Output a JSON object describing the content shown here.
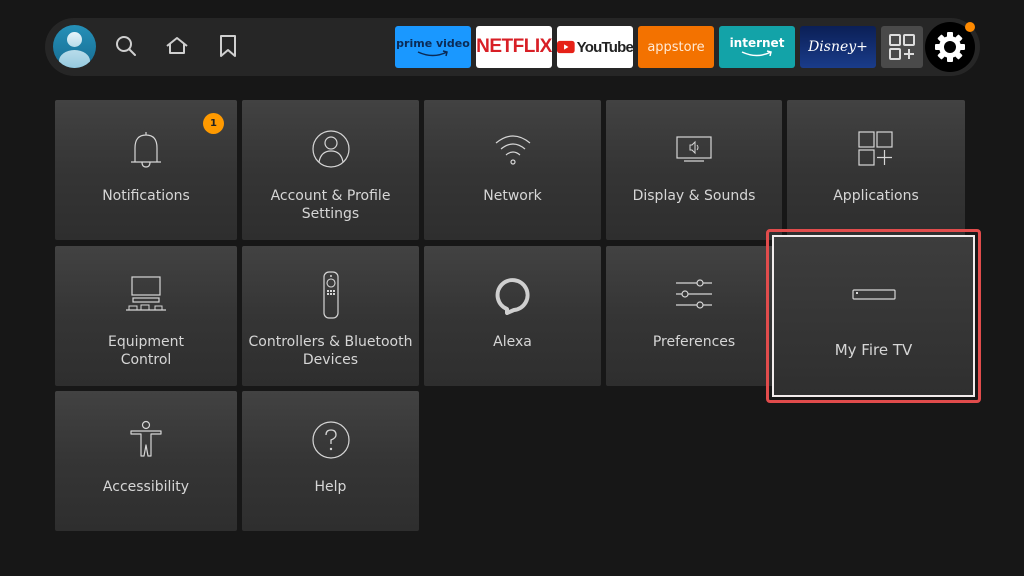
{
  "topbar": {
    "nav": [
      {
        "name": "profile",
        "icon": "avatar-icon"
      },
      {
        "name": "search",
        "icon": "search-icon"
      },
      {
        "name": "home",
        "icon": "home-icon"
      },
      {
        "name": "watchlist",
        "icon": "bookmark-icon"
      }
    ],
    "apps": [
      {
        "label": "prime video",
        "brand_color": "#1a98ff"
      },
      {
        "label": "NETFLIX",
        "brand_color": "#d81f26"
      },
      {
        "label": "YouTube",
        "brand_color": "#ff0000"
      },
      {
        "label": "appstore",
        "brand_color": "#f37200"
      },
      {
        "label": "internet",
        "brand_color": "#13a3a8"
      },
      {
        "label": "Disney+",
        "brand_color": "#0b1f56"
      }
    ],
    "all_apps_icon": "apps-grid-icon",
    "settings_icon": "gear-icon",
    "settings_alert_color": "#ff8a00"
  },
  "settings": {
    "tiles": [
      {
        "label": "Notifications",
        "icon": "bell-icon",
        "badge": "1"
      },
      {
        "label": "Account & Profile Settings",
        "icon": "user-circle-icon"
      },
      {
        "label": "Network",
        "icon": "wifi-icon"
      },
      {
        "label": "Display & Sounds",
        "icon": "display-icon"
      },
      {
        "label": "Applications",
        "icon": "apps-icon"
      },
      {
        "label": "Equipment Control",
        "icon": "equipment-icon"
      },
      {
        "label": "Controllers & Bluetooth Devices",
        "icon": "remote-icon"
      },
      {
        "label": "Alexa",
        "icon": "alexa-icon"
      },
      {
        "label": "Preferences",
        "icon": "sliders-icon"
      },
      {
        "label": "My Fire TV",
        "icon": "fire-tv-stick-icon",
        "focused": true
      },
      {
        "label": "Accessibility",
        "icon": "accessibility-icon"
      },
      {
        "label": "Help",
        "icon": "help-icon"
      }
    ],
    "focus_color": "#e14c4c"
  }
}
